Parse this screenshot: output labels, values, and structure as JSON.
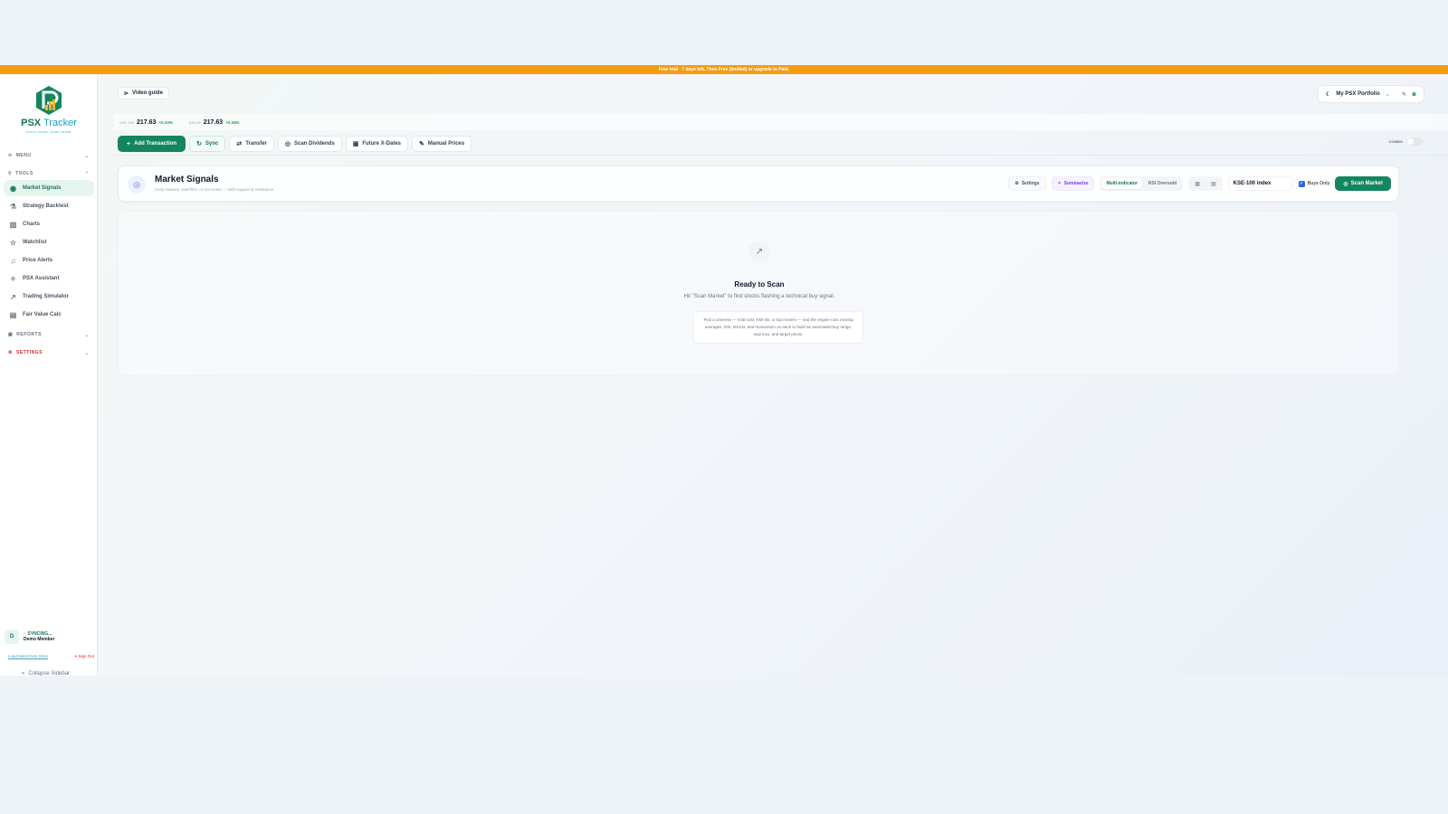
{
  "banner": {
    "text": "Free trial · 7 days left. Then Free (limited) or upgrade to Paid."
  },
  "brand": {
    "name_part1": "PSX",
    "name_part2": " Tracker",
    "tagline": "TRACK MORE. EARN MORE."
  },
  "sidebar": {
    "sections": {
      "menu": "MENU",
      "tools": "TOOLS",
      "reports": "REPORTS",
      "settings": "SETTINGS"
    },
    "items": [
      {
        "label": "Market Signals",
        "icon": "signal-icon"
      },
      {
        "label": "Strategy Backtest",
        "icon": "flask-icon"
      },
      {
        "label": "Charts",
        "icon": "bar-chart-icon"
      },
      {
        "label": "Watchlist",
        "icon": "star-icon"
      },
      {
        "label": "Price Alerts",
        "icon": "bell-icon"
      },
      {
        "label": "PSX Assistant",
        "icon": "sparkle-icon"
      },
      {
        "label": "Trading Simulator",
        "icon": "trend-icon"
      },
      {
        "label": "Fair Value Calc",
        "icon": "calculator-icon"
      }
    ],
    "active_item": "Market Signals",
    "user": {
      "initial": "D",
      "sync_state": "◌ SYNCING...",
      "name": "Demo Member"
    },
    "load_link": "Load latest from Drive",
    "sign_out": "Sign Out",
    "collapse": "Collapse Sidebar"
  },
  "header": {
    "video_guide": "Video guide",
    "portfolio": "My PSX Portfolio"
  },
  "indices": [
    {
      "label": "KSE-100",
      "value": "217.63",
      "change": "+0.34%"
    },
    {
      "label": "KMI-30",
      "value": "217.63",
      "change": "+0.34%"
    }
  ],
  "toolbar": {
    "add_transaction": "Add Transaction",
    "sync": "Sync",
    "transfer": "Transfer",
    "scan_dividends": "Scan Dividends",
    "future_x_dates": "Future X-Dates",
    "manual_prices": "Manual Prices",
    "combo": "COMBO"
  },
  "signals": {
    "title": "Market Signals",
    "subtitle": "Scan indexes, watchlist, or one ticker — with support & resistance",
    "settings": "Settings",
    "summarize": "Summarize",
    "modes": [
      "Multi-indicator",
      "RSI Oversold"
    ],
    "active_mode": "Multi-indicator",
    "universe": "KSE-100 index",
    "buys_only": "Buys Only",
    "buys_only_checked": true,
    "scan_button": "Scan Market"
  },
  "empty_state": {
    "title": "Ready to Scan",
    "subtitle": "Hit \"Scan Market\" to find stocks flashing a technical buy signal.",
    "hint": "Pick a universe — KSE-100, KMI-30, or top movers — and the engine runs moving averages, RSI, MACD, and momentum on each to build an automated buy range, stop loss, and target prices."
  },
  "colors": {
    "accent": "#13855f",
    "banner": "#f39c12",
    "positive": "#16a34a",
    "danger": "#dc2626"
  }
}
